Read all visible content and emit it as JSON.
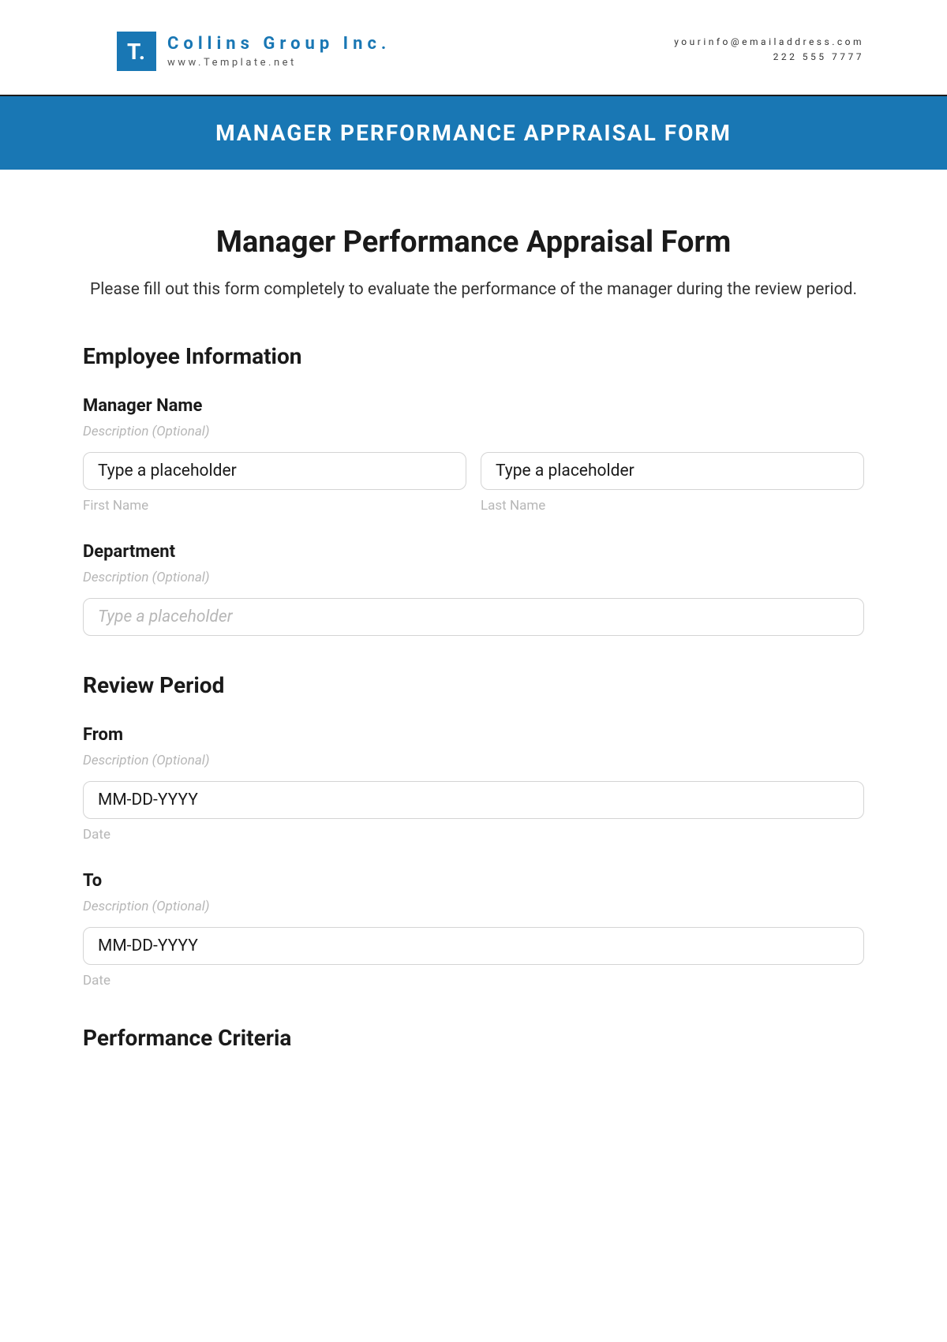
{
  "letterhead": {
    "logo_text": "T.",
    "company": "Collins Group Inc.",
    "website": "www.Template.net",
    "email": "yourinfo@emailaddress.com",
    "phone": "222 555 7777"
  },
  "banner": "MANAGER PERFORMANCE APPRAISAL FORM",
  "form": {
    "title": "Manager Performance Appraisal Form",
    "intro": "Please fill out this form completely to evaluate the performance of the manager during the review period."
  },
  "sections": {
    "employee_info": {
      "heading": "Employee Information",
      "manager_name": {
        "label": "Manager Name",
        "desc": "Description (Optional)",
        "first_placeholder": "Type a placeholder",
        "first_sublabel": "First Name",
        "last_placeholder": "Type a placeholder",
        "last_sublabel": "Last Name"
      },
      "department": {
        "label": "Department",
        "desc": "Description (Optional)",
        "placeholder": "Type a placeholder"
      }
    },
    "review_period": {
      "heading": "Review Period",
      "from": {
        "label": "From",
        "desc": "Description (Optional)",
        "placeholder": "MM-DD-YYYY",
        "sublabel": "Date"
      },
      "to": {
        "label": "To",
        "desc": "Description (Optional)",
        "placeholder": "MM-DD-YYYY",
        "sublabel": "Date"
      }
    },
    "performance_criteria": {
      "heading": "Performance Criteria"
    }
  }
}
